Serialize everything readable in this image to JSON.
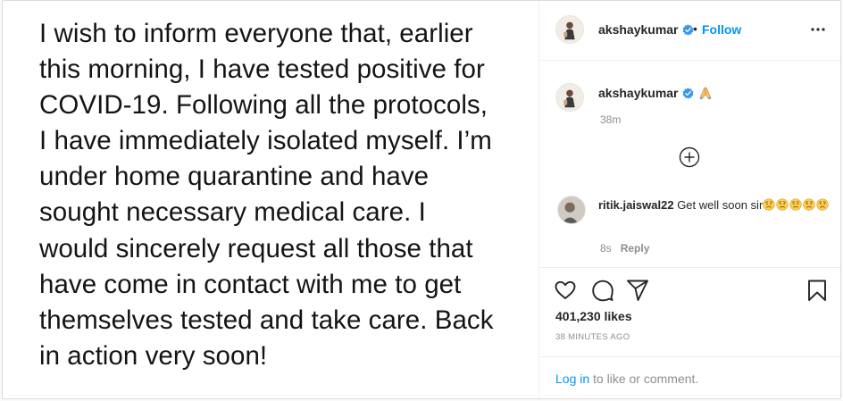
{
  "post": {
    "image_text": "I wish to inform everyone that, earlier\nthis morning, I have tested positive for\nCOVID-19. Following all the protocols,\nI have immediately isolated myself. I’m\nunder home quarantine and have\nsought necessary medical care. I\nwould sincerely request all those that\nhave come in contact with me to get\nthemselves tested and take care. Back\nin action very soon!"
  },
  "header": {
    "username": "akshaykumar",
    "separator": "•",
    "follow_label": "Follow"
  },
  "caption": {
    "username": "akshaykumar",
    "time": "38m"
  },
  "comment": {
    "username": "ritik.jaiswal22",
    "text": "Get well soon sir",
    "emoji_count": 5,
    "time": "8s",
    "reply_label": "Reply"
  },
  "engagement": {
    "likes": "401,230 likes",
    "timestamp": "38 MINUTES AGO"
  },
  "login_prompt": {
    "link": "Log in",
    "text": " to like or comment."
  },
  "icons": {
    "verified": "verified-badge-icon",
    "pray": "folded-hands-emoji",
    "more": "more-options-icon",
    "load_more": "plus-circle-icon",
    "like": "heart-icon",
    "comment": "comment-bubble-icon",
    "share": "paper-plane-icon",
    "save": "bookmark-icon",
    "emoji": "worried-face-emoji"
  },
  "colors": {
    "link_blue": "#0095f6",
    "verified_blue": "#3897f0",
    "text": "#262626",
    "muted": "#8e8e8e",
    "border": "#dbdbdb"
  }
}
